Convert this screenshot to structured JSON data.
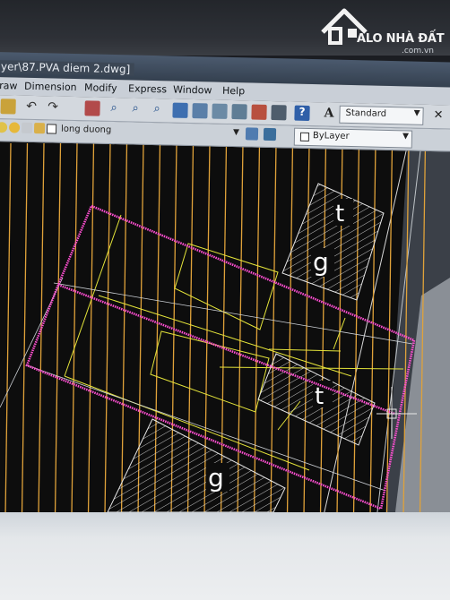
{
  "window": {
    "title": "ayer\\87.PVA diem 2.dwg]"
  },
  "menu": [
    "raw",
    "Dimension",
    "Modify",
    "Express",
    "Window",
    "Help"
  ],
  "toolbar": {
    "text_style_value": "Standard",
    "layer_value": "long duong",
    "color_value": "ByLayer"
  },
  "watermark": {
    "brand": "ALO NHÀ ĐẤT",
    "domain": ".com.vn"
  },
  "drawing": {
    "labels": [
      "t",
      "g",
      "t",
      "g"
    ],
    "colors": {
      "background": "#0d0d0d",
      "grid_lines": "#e0a23a",
      "lot_outline": "#ff4fd2",
      "structure": "#e4e43a",
      "hatch": "#e0e0e0",
      "road": "#5a6068"
    }
  },
  "icons": [
    "undo-icon",
    "redo-icon",
    "zoom-icon",
    "help-icon",
    "text-style-icon",
    "layer-icon"
  ]
}
